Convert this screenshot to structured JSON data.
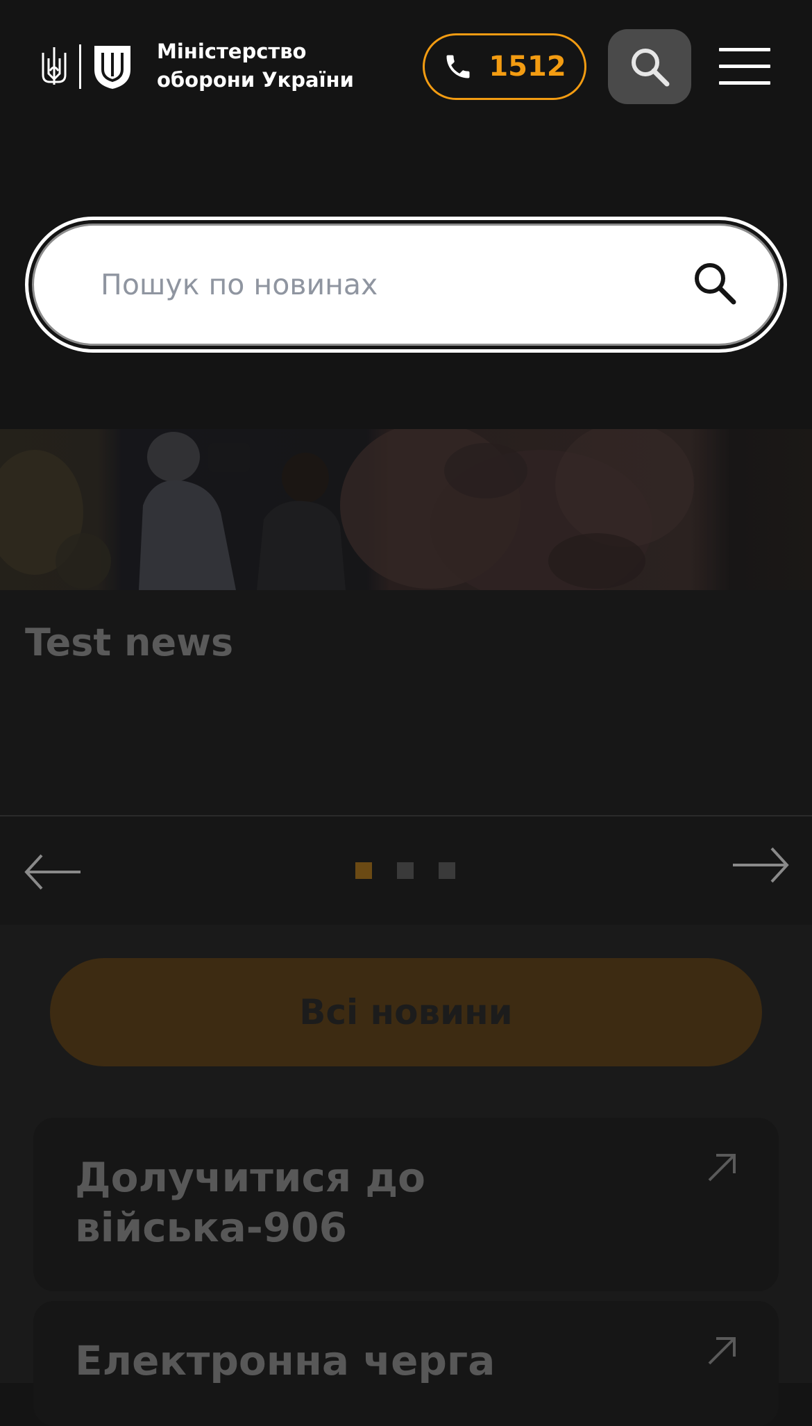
{
  "header": {
    "ministry_name_line1": "Міністерство",
    "ministry_name_line2": "оборони України",
    "phone_number": "1512",
    "icons": {
      "logo": "ukraine-trident-and-shield-logo",
      "phone": "phone-icon",
      "search": "search-icon",
      "menu": "hamburger-menu-icon"
    }
  },
  "search": {
    "placeholder": "Пошук по новинах",
    "value": ""
  },
  "news_slider": {
    "title": "Test news",
    "slide_count": 3,
    "active_slide": 1
  },
  "all_news_button": "Всі новини",
  "links": [
    {
      "label": "Долучитися до війська-906"
    },
    {
      "label": "Електронна черга"
    }
  ],
  "colors": {
    "background": "#141414",
    "accent": "#f39c12",
    "search_button_bg": "#4a4a4a",
    "all_news_button_bg": "#3d2b12",
    "card_bg": "#161616",
    "muted_text": "#585858"
  }
}
